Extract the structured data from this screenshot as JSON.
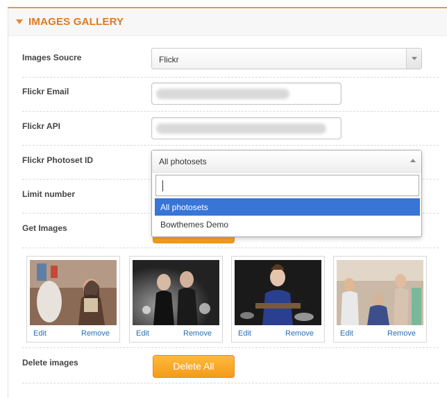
{
  "panel": {
    "title": "IMAGES GALLERY"
  },
  "fields": {
    "source": {
      "label": "Images Soucre",
      "value": "Flickr"
    },
    "email": {
      "label": "Flickr Email"
    },
    "api": {
      "label": "Flickr API"
    },
    "photoset": {
      "label": "Flickr Photoset ID",
      "selected": "All photosets",
      "search_value": "",
      "options": [
        "All photosets",
        "Bowthemes Demo"
      ]
    },
    "limit": {
      "label": "Limit number"
    },
    "get_images": {
      "label": "Get Images"
    },
    "delete_images": {
      "label": "Delete images",
      "button": "Delete All"
    }
  },
  "gallery": {
    "items": [
      {
        "edit": "Edit",
        "remove": "Remove"
      },
      {
        "edit": "Edit",
        "remove": "Remove"
      },
      {
        "edit": "Edit",
        "remove": "Remove"
      },
      {
        "edit": "Edit",
        "remove": "Remove"
      }
    ]
  },
  "colors": {
    "accent": "#e0781f",
    "button": "#f7a21f",
    "selection": "#3875d7",
    "link": "#2a6db0"
  }
}
